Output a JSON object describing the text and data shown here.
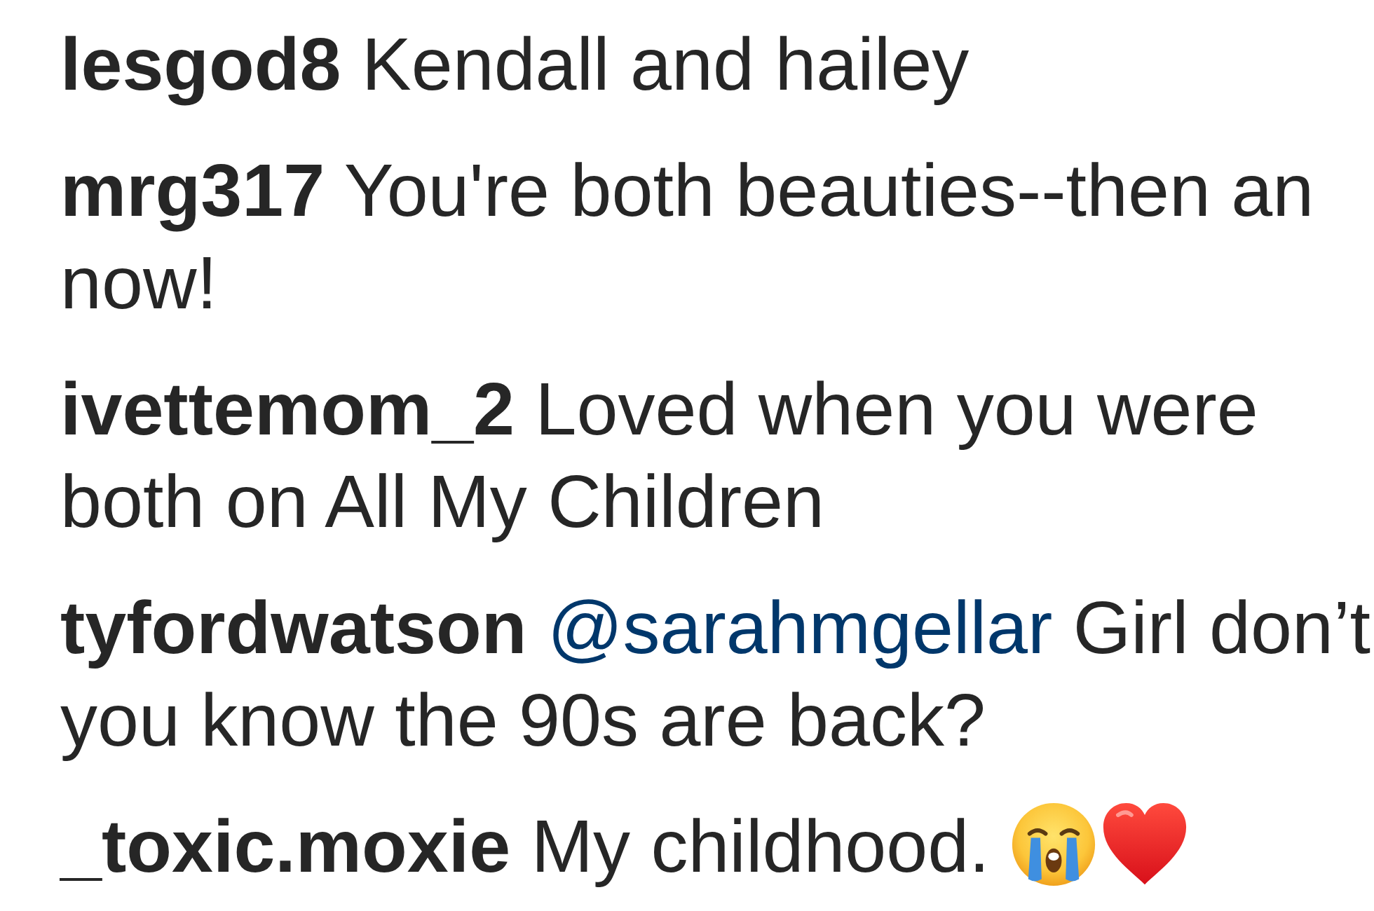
{
  "comments": [
    {
      "username": "lesgod8",
      "lines": [
        "Kendall and hailey"
      ]
    },
    {
      "username": "mrg317",
      "lines": [
        "You're both beauties--then an",
        "now!"
      ]
    },
    {
      "username": "ivettemom_2",
      "lines": [
        "Loved when you were",
        "both on All My Children"
      ]
    },
    {
      "username": "tyfordwatson",
      "mention": "@sarahmgellar",
      "lines": [
        "Girl don’t",
        "you know the 90s are back?"
      ]
    },
    {
      "username": "_toxic.moxie",
      "lines": [
        "My childhood."
      ],
      "emoji": [
        {
          "kind": "crying-face"
        },
        {
          "kind": "heart"
        }
      ]
    }
  ]
}
